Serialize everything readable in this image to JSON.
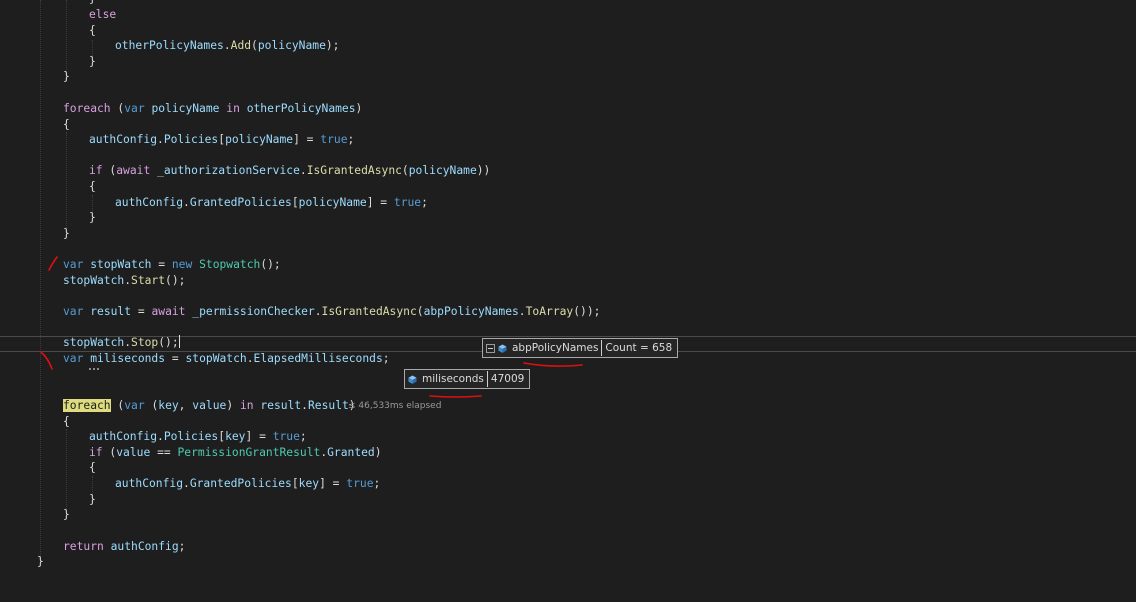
{
  "code": {
    "line_else": "else",
    "line_add_call": "otherPolicyNames.Add(policyName);",
    "line_foreach1": "foreach (var policyName in otherPolicyNames)",
    "line_policies_true": "authConfig.Policies[policyName] = true;",
    "line_if_granted": "if (await _authorizationService.IsGrantedAsync(policyName))",
    "line_granted_true": "authConfig.GrantedPolicies[policyName] = true;",
    "line_stopwatch_new": "var stopWatch = new Stopwatch();",
    "line_start": "stopWatch.Start();",
    "line_result": "var result = await _permissionChecker.IsGrantedAsync(abpPolicyNames.ToArray());",
    "line_stop": "stopWatch.Stop();",
    "line_miliseconds": "var miliseconds = stopWatch.ElapsedMilliseconds;",
    "line_foreach2_keyword": "foreach",
    "line_foreach2_rest": "(var (key, value) in result.Result)",
    "line_policies_key": "authConfig.Policies[key] = true;",
    "line_if_value": "if (value == PermissionGrantResult.Granted)",
    "line_granted_key": "authConfig.GrantedPolicies[key] = true;",
    "line_return": "return authConfig;",
    "brace_open": "{",
    "brace_close": "}"
  },
  "perf_tip": "≤ 46,533ms elapsed",
  "datatips": [
    {
      "name": "abpPolicyNames",
      "value": "Count = 658",
      "icon": "field-cube-icon"
    },
    {
      "name": "miliseconds",
      "value": "47009",
      "icon": "field-cube-icon"
    }
  ],
  "colors": {
    "background": "#1e1e1e",
    "keyword": "#569cd6",
    "control_keyword": "#d8a0df",
    "identifier": "#9cdcfe",
    "type": "#4ec9b0",
    "method": "#dcdcaa",
    "annotation_red": "#e01010"
  }
}
